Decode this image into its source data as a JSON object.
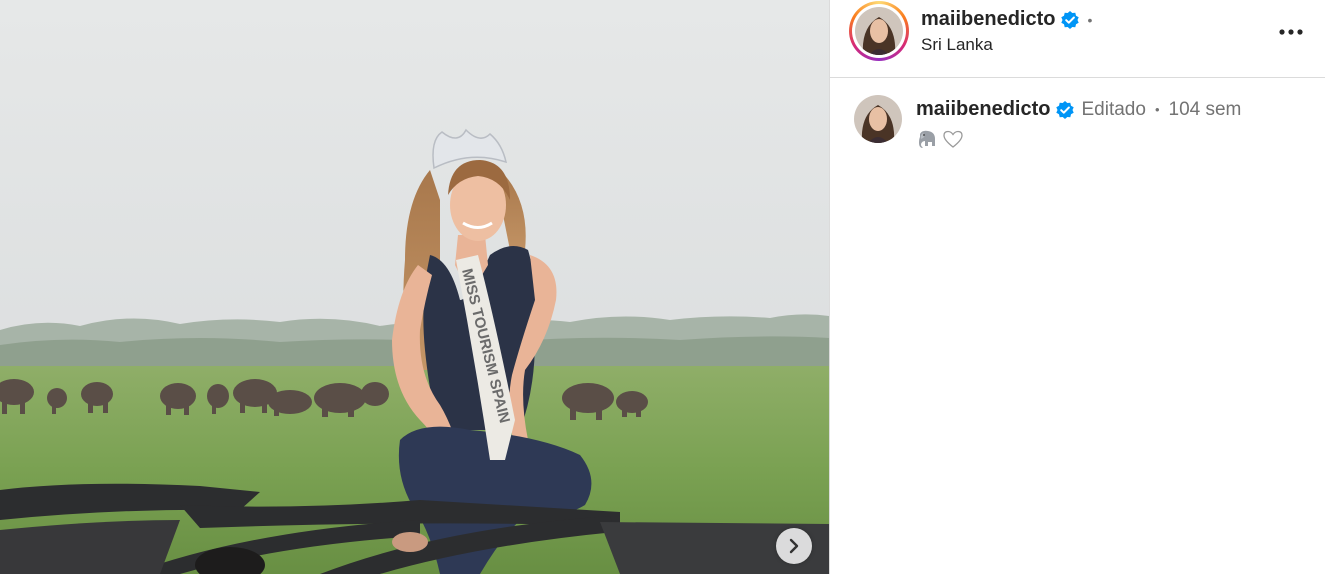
{
  "post": {
    "username": "maiibenedicto",
    "location": "Sri Lanka",
    "header_dot": "•"
  },
  "caption": {
    "username": "maiibenedicto",
    "edited_label": "Editado",
    "separator": "•",
    "time": "104 sem",
    "emojis": [
      "elephant-emoji",
      "white-heart-emoji"
    ]
  },
  "media": {
    "sash_text": "MISS TOURISM SPAIN",
    "next_icon": "chevron-right-icon"
  },
  "icons": {
    "more": "more-options-icon",
    "verified": "verified-badge-icon"
  },
  "colors": {
    "verified_blue": "#0095f6",
    "text_primary": "#262626",
    "text_secondary": "#737373",
    "divider": "#dbdbdb"
  }
}
